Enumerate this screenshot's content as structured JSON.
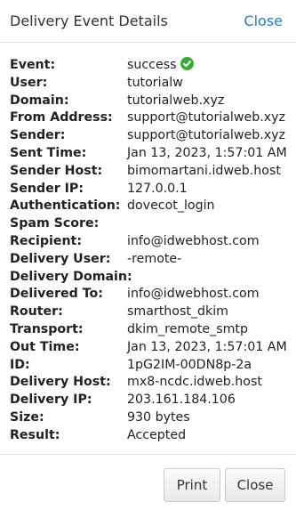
{
  "header": {
    "title": "Delivery Event Details",
    "close_label": "Close"
  },
  "details": [
    {
      "label": "Event:",
      "value": "success",
      "icon": "check-circle-icon",
      "icon_color": "#3aaa35"
    },
    {
      "label": "User:",
      "value": "tutorialw"
    },
    {
      "label": "Domain:",
      "value": "tutorialweb.xyz"
    },
    {
      "label": "From Address:",
      "value": "support@tutorialweb.xyz"
    },
    {
      "label": "Sender:",
      "value": "support@tutorialweb.xyz"
    },
    {
      "label": "Sent Time:",
      "value": "Jan 13, 2023, 1:57:01 AM"
    },
    {
      "label": "Sender Host:",
      "value": "bimomartani.idweb.host"
    },
    {
      "label": "Sender IP:",
      "value": "127.0.0.1"
    },
    {
      "label": "Authentication:",
      "value": "dovecot_login"
    },
    {
      "label": "Spam Score:",
      "value": ""
    },
    {
      "label": "Recipient:",
      "value": "info@idwebhost.com"
    },
    {
      "label": "Delivery User:",
      "value": "-remote-"
    },
    {
      "label": "Delivery Domain:",
      "value": ""
    },
    {
      "label": "Delivered To:",
      "value": "info@idwebhost.com"
    },
    {
      "label": "Router:",
      "value": "smarthost_dkim"
    },
    {
      "label": "Transport:",
      "value": "dkim_remote_smtp"
    },
    {
      "label": "Out Time:",
      "value": "Jan 13, 2023, 1:57:01 AM"
    },
    {
      "label": "ID:",
      "value": "1pG2IM-00DN8p-2a"
    },
    {
      "label": "Delivery Host:",
      "value": "mx8-ncdc.idweb.host"
    },
    {
      "label": "Delivery IP:",
      "value": "203.161.184.106"
    },
    {
      "label": "Size:",
      "value": "930 bytes"
    },
    {
      "label": "Result:",
      "value": "Accepted"
    }
  ],
  "footer": {
    "print_label": "Print",
    "close_label": "Close"
  },
  "colors": {
    "link": "#1d7fc7",
    "success": "#3aaa35"
  }
}
